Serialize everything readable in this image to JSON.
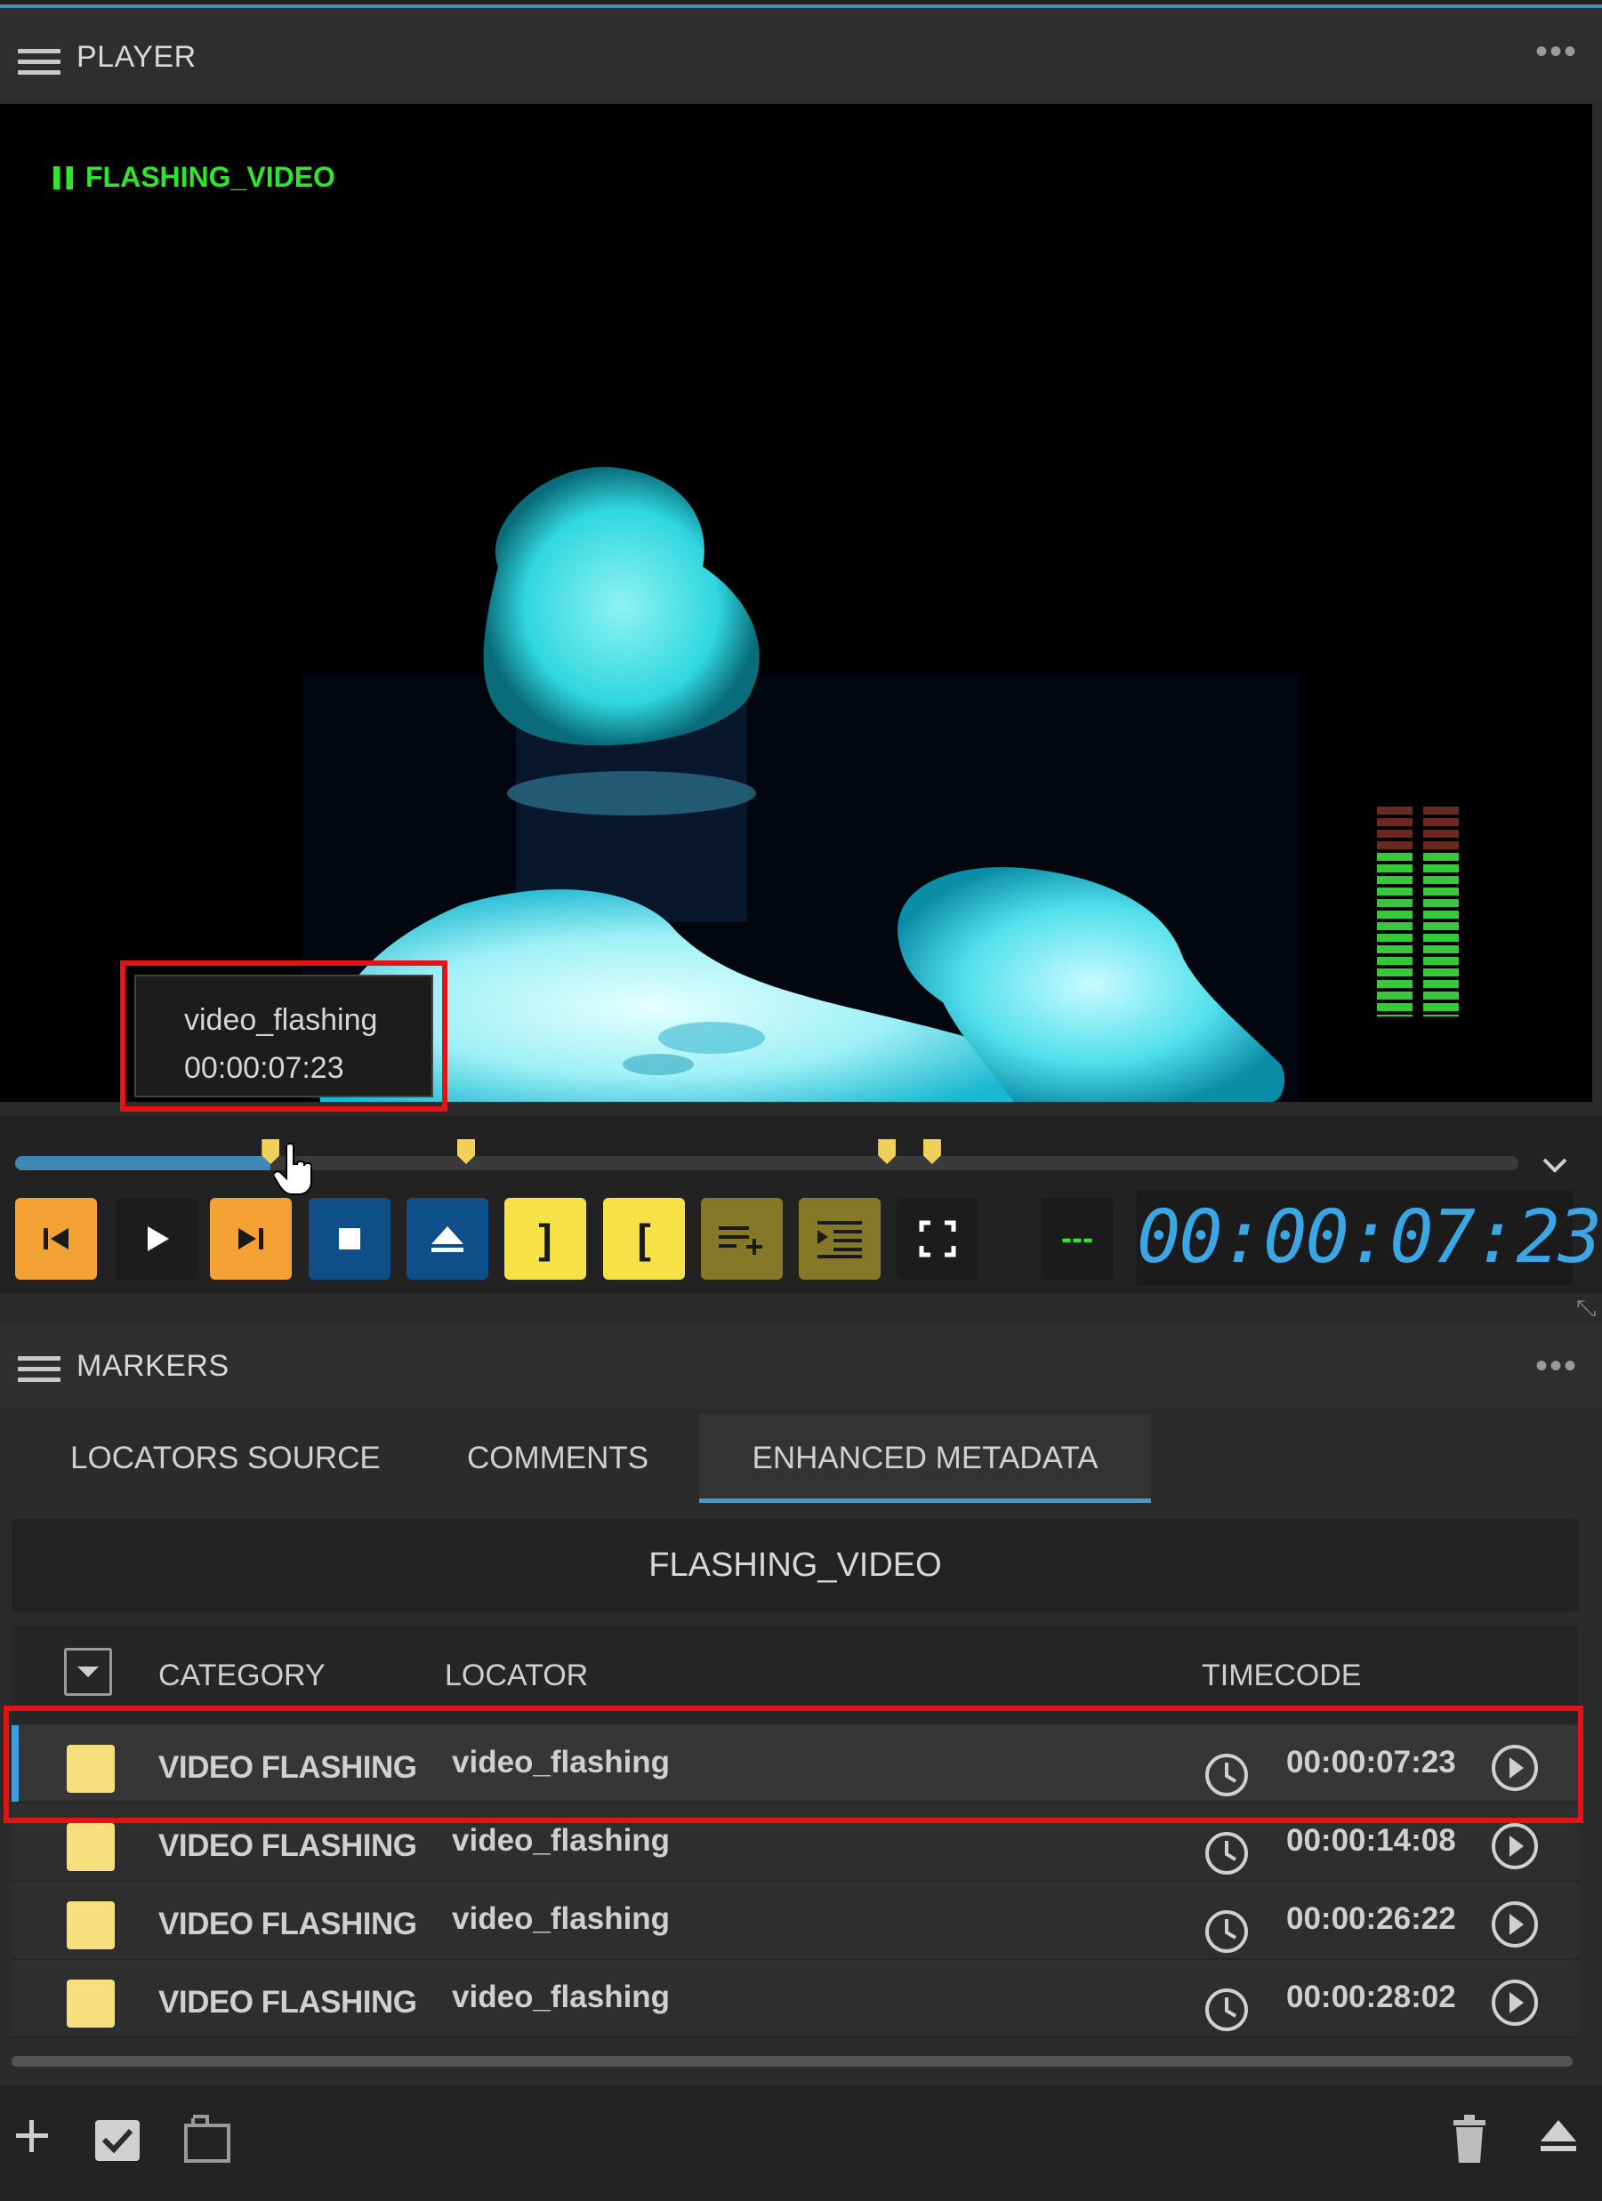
{
  "player": {
    "title": "PLAYER",
    "menu_icon": "hamburger-icon",
    "more_icon": "more-dots-icon",
    "video": {
      "clip_name": "FLASHING_VIDEO",
      "state_icon": "pause-icon",
      "audio_meter_icon": "audio-level-meter"
    },
    "tooltip": {
      "name": "video_flashing",
      "timecode": "00:00:07:23"
    },
    "timeline": {
      "progress": 0.17,
      "marker_positions": [
        0.17,
        0.3,
        0.58,
        0.61
      ],
      "collapse_icon": "chevron-down-icon"
    },
    "controls": [
      {
        "name": "go-to-start-button",
        "icon": "skip-back-icon",
        "color": "#f4a234"
      },
      {
        "name": "play-button",
        "icon": "play-icon",
        "color": "#1c1c1c"
      },
      {
        "name": "go-to-end-button",
        "icon": "skip-forward-icon",
        "color": "#f4a234"
      },
      {
        "name": "stop-button",
        "icon": "stop-icon",
        "color": "#0e4f8a"
      },
      {
        "name": "eject-button",
        "icon": "eject-icon",
        "color": "#0e4f8a"
      },
      {
        "name": "mark-out-button",
        "icon": "mark-out-icon",
        "label": "]",
        "color": "#f6e246"
      },
      {
        "name": "mark-in-button",
        "icon": "mark-in-icon",
        "label": "[",
        "color": "#f6e246"
      },
      {
        "name": "add-to-list-button",
        "icon": "playlist-add-icon",
        "color": "#857826"
      },
      {
        "name": "insert-button",
        "icon": "insert-list-icon",
        "color": "#857826"
      },
      {
        "name": "fullscreen-button",
        "icon": "fullscreen-icon",
        "color": "#1c1c1c"
      }
    ],
    "level_text": "---",
    "timecode": "00:00:07:23"
  },
  "markers": {
    "title": "MARKERS",
    "tabs": [
      {
        "label": "LOCATORS SOURCE",
        "active": false
      },
      {
        "label": "COMMENTS",
        "active": false
      },
      {
        "label": "ENHANCED METADATA",
        "active": true
      }
    ],
    "clip_title": "FLASHING_VIDEO",
    "columns": {
      "category": "CATEGORY",
      "locator": "LOCATOR",
      "timecode": "TIMECODE"
    },
    "rows": [
      {
        "category": "VIDEO FLASHING",
        "locator": "video_flashing",
        "timecode": "00:00:07:23",
        "color": "#f8df7e",
        "selected": true
      },
      {
        "category": "VIDEO FLASHING",
        "locator": "video_flashing",
        "timecode": "00:00:14:08",
        "color": "#f8df7e",
        "selected": false
      },
      {
        "category": "VIDEO FLASHING",
        "locator": "video_flashing",
        "timecode": "00:00:26:22",
        "color": "#f8df7e",
        "selected": false
      },
      {
        "category": "VIDEO FLASHING",
        "locator": "video_flashing",
        "timecode": "00:00:28:02",
        "color": "#f8df7e",
        "selected": false
      }
    ],
    "bottom_icons": [
      "plus-icon",
      "checkbox-icon",
      "copy-icon",
      "trash-icon",
      "eject-icon"
    ]
  }
}
